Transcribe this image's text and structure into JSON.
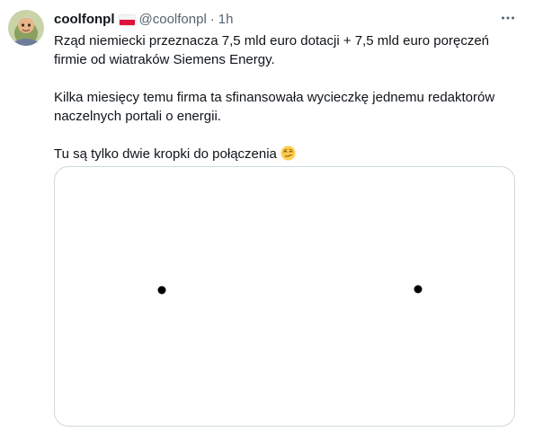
{
  "tweet": {
    "display_name": "coolfonpl",
    "handle": "@coolfonpl",
    "separator": "·",
    "time": "1h",
    "paragraphs": [
      "Rząd niemiecki przeznacza 7,5 mld euro dotacji + 7,5 mld euro poręczeń firmie od wiatraków Siemens Energy.",
      "Kilka miesięcy temu firma ta sfinansowała wycieczkę jednemu redaktorów naczelnych portali o energii.",
      "Tu są tylko dwie kropki do połączenia"
    ],
    "emoji": "smirking-face",
    "flag": "poland-flag",
    "media": {
      "dots": 2,
      "dot_color": "#000000"
    }
  },
  "colors": {
    "text_primary": "#0f1419",
    "text_secondary": "#536471",
    "border": "#cfd9de",
    "flag_red": "#dc143c"
  },
  "icons": {
    "more": "more-options-icon"
  }
}
